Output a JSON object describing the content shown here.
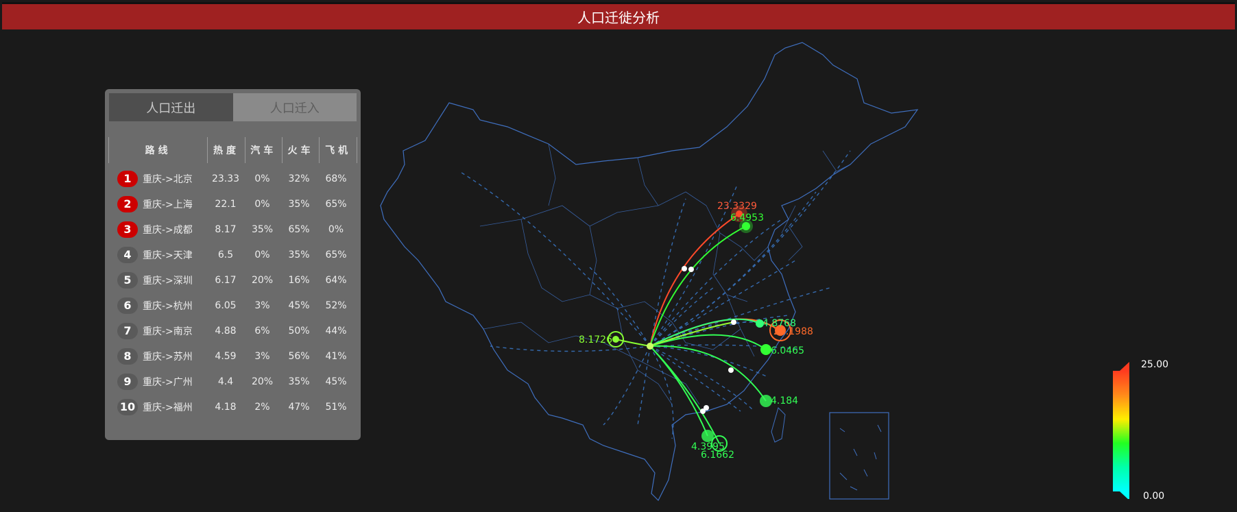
{
  "header": {
    "title": "人口迁徙分析"
  },
  "tabs": [
    {
      "label": "人口迁出",
      "active": true
    },
    {
      "label": "人口迁入",
      "active": false
    }
  ],
  "table": {
    "columns": [
      "路线",
      "热度",
      "汽车",
      "火车",
      "飞机"
    ],
    "rows": [
      {
        "rank": "1",
        "route": "重庆->北京",
        "heat": "23.33",
        "car": "0%",
        "train": "32%",
        "plane": "68%"
      },
      {
        "rank": "2",
        "route": "重庆->上海",
        "heat": "22.1",
        "car": "0%",
        "train": "35%",
        "plane": "65%"
      },
      {
        "rank": "3",
        "route": "重庆->成都",
        "heat": "8.17",
        "car": "35%",
        "train": "65%",
        "plane": "0%"
      },
      {
        "rank": "4",
        "route": "重庆->天津",
        "heat": "6.5",
        "car": "0%",
        "train": "35%",
        "plane": "65%"
      },
      {
        "rank": "5",
        "route": "重庆->深圳",
        "heat": "6.17",
        "car": "20%",
        "train": "16%",
        "plane": "64%"
      },
      {
        "rank": "6",
        "route": "重庆->杭州",
        "heat": "6.05",
        "car": "3%",
        "train": "45%",
        "plane": "52%"
      },
      {
        "rank": "7",
        "route": "重庆->南京",
        "heat": "4.88",
        "car": "6%",
        "train": "50%",
        "plane": "44%"
      },
      {
        "rank": "8",
        "route": "重庆->苏州",
        "heat": "4.59",
        "car": "3%",
        "train": "56%",
        "plane": "41%"
      },
      {
        "rank": "9",
        "route": "重庆->广州",
        "heat": "4.4",
        "car": "20%",
        "train": "35%",
        "plane": "45%"
      },
      {
        "rank": "10",
        "route": "重庆->福州",
        "heat": "4.18",
        "car": "2%",
        "train": "47%",
        "plane": "51%"
      }
    ]
  },
  "map": {
    "labels": {
      "beijing": "23.3329",
      "tianjin": "6.4953",
      "chengdu": "8.1726",
      "nanjing": "4.8768",
      "shanghai": "22.1988",
      "hangzhou": "6.0465",
      "fuzhou": "4.184",
      "guangzhou": "4.3995",
      "shenzhen": "6.1662"
    }
  },
  "legend": {
    "max": "25.00",
    "min": "0.00"
  },
  "colors": {
    "header": "#9f2121",
    "hot": "#ff4a2a",
    "cool": "#22ff22",
    "border": "#3f6fbf"
  }
}
